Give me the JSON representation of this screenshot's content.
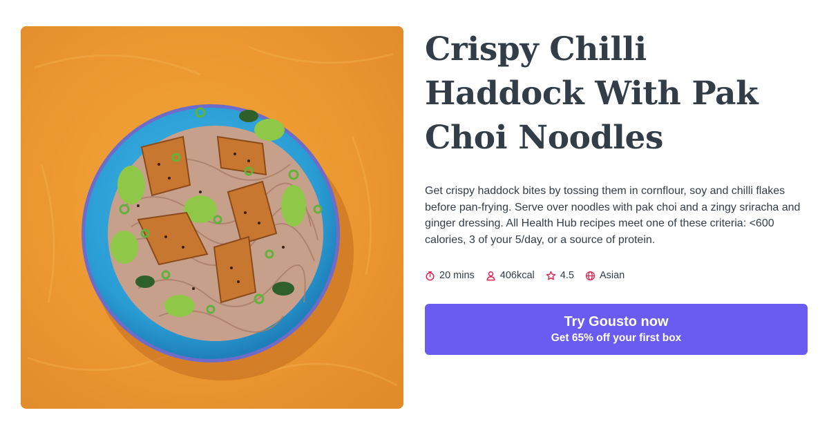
{
  "recipe": {
    "title": "Crispy Chilli Haddock With Pak Choi Noodles",
    "description": "Get crispy haddock bites by tossing them in cornflour, soy and chilli flakes before pan-frying. Serve over noodles with pak choi and a zingy sriracha and ginger dressing. All Health Hub recipes meet one of these criteria: <600 calories, 3 of your 5/day, or a source of protein.",
    "image_alt": "Bowl of crispy chilli haddock with pak choi noodles on an orange background"
  },
  "meta": {
    "time": {
      "label": "20 mins",
      "icon": "timer-icon"
    },
    "calories": {
      "label": "406kcal",
      "icon": "person-icon"
    },
    "rating": {
      "label": "4.5",
      "icon": "star-icon"
    },
    "cuisine": {
      "label": "Asian",
      "icon": "globe-icon"
    }
  },
  "cta": {
    "title": "Try Gousto now",
    "subtitle": "Get 65% off your first box"
  },
  "colors": {
    "heading": "#333d47",
    "icon_accent": "#e0224f",
    "cta_background": "#6b5cf1",
    "cta_text": "#ffffff",
    "photo_background": "#e9952e"
  }
}
